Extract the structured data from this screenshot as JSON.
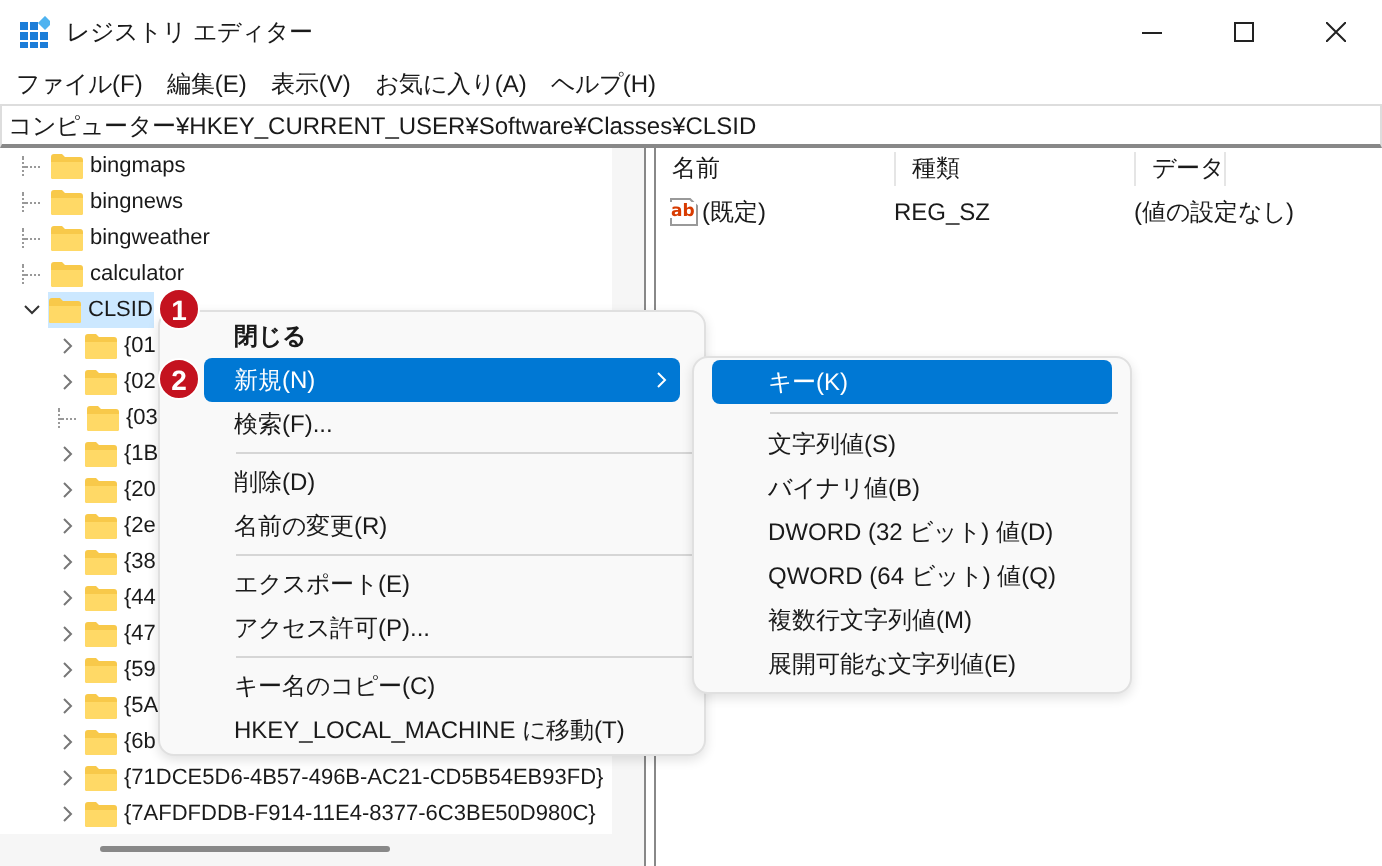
{
  "window": {
    "title": "レジストリ エディター"
  },
  "menu_bar": [
    "ファイル(F)",
    "編集(E)",
    "表示(V)",
    "お気に入り(A)",
    "ヘルプ(H)"
  ],
  "address": "コンピューター¥HKEY_CURRENT_USER¥Software¥Classes¥CLSID",
  "tree": [
    {
      "label": "bingmaps",
      "has_children": false,
      "selected": false
    },
    {
      "label": "bingnews",
      "has_children": false,
      "selected": false
    },
    {
      "label": "bingweather",
      "has_children": false,
      "selected": false
    },
    {
      "label": "calculator",
      "has_children": false,
      "selected": false
    },
    {
      "label": "CLSID",
      "has_children": true,
      "expanded": true,
      "selected": true,
      "children": [
        {
          "label": "{01",
          "has_children": true,
          "expanded": false,
          "selected": false
        },
        {
          "label": "{02",
          "has_children": true,
          "expanded": false,
          "selected": false
        },
        {
          "label": "{03",
          "has_children": false,
          "selected": false
        },
        {
          "label": "{1B",
          "has_children": true,
          "expanded": false,
          "selected": false
        },
        {
          "label": "{20",
          "has_children": true,
          "expanded": false,
          "selected": false
        },
        {
          "label": "{2e",
          "has_children": true,
          "expanded": false,
          "selected": false
        },
        {
          "label": "{38",
          "has_children": true,
          "expanded": false,
          "selected": false
        },
        {
          "label": "{44",
          "has_children": true,
          "expanded": false,
          "selected": false
        },
        {
          "label": "{47",
          "has_children": true,
          "expanded": false,
          "selected": false
        },
        {
          "label": "{59",
          "has_children": true,
          "expanded": false,
          "selected": false
        },
        {
          "label": "{5A",
          "has_children": true,
          "expanded": false,
          "selected": false
        },
        {
          "label": "{6b",
          "has_children": true,
          "expanded": false,
          "selected": false
        },
        {
          "label": "{71DCE5D6-4B57-496B-AC21-CD5B54EB93FD}",
          "has_children": true,
          "expanded": false,
          "selected": false
        },
        {
          "label": "{7AFDFDDB-F914-11E4-8377-6C3BE50D980C}",
          "has_children": true,
          "expanded": false,
          "selected": false
        }
      ]
    }
  ],
  "list": {
    "columns": [
      "名前",
      "種類",
      "データ"
    ],
    "rows": [
      {
        "icon": "ab",
        "name": "(既定)",
        "type": "REG_SZ",
        "data": "(値の設定なし)"
      }
    ]
  },
  "context_menu": [
    {
      "kind": "item",
      "label": "閉じる",
      "default": true,
      "selected": false,
      "has_submenu": false
    },
    {
      "kind": "item",
      "label": "新規(N)",
      "default": false,
      "selected": true,
      "has_submenu": true
    },
    {
      "kind": "item",
      "label": "検索(F)...",
      "default": false,
      "selected": false,
      "has_submenu": false
    },
    {
      "kind": "separator"
    },
    {
      "kind": "item",
      "label": "削除(D)",
      "default": false,
      "selected": false,
      "has_submenu": false
    },
    {
      "kind": "item",
      "label": "名前の変更(R)",
      "default": false,
      "selected": false,
      "has_submenu": false
    },
    {
      "kind": "separator"
    },
    {
      "kind": "item",
      "label": "エクスポート(E)",
      "default": false,
      "selected": false,
      "has_submenu": false
    },
    {
      "kind": "item",
      "label": "アクセス許可(P)...",
      "default": false,
      "selected": false,
      "has_submenu": false
    },
    {
      "kind": "separator"
    },
    {
      "kind": "item",
      "label": "キー名のコピー(C)",
      "default": false,
      "selected": false,
      "has_submenu": false
    },
    {
      "kind": "item",
      "label": "HKEY_LOCAL_MACHINE に移動(T)",
      "default": false,
      "selected": false,
      "has_submenu": false
    }
  ],
  "submenu": [
    {
      "kind": "item",
      "label": "キー(K)",
      "selected": true
    },
    {
      "kind": "separator"
    },
    {
      "kind": "item",
      "label": "文字列値(S)",
      "selected": false
    },
    {
      "kind": "item",
      "label": "バイナリ値(B)",
      "selected": false
    },
    {
      "kind": "item",
      "label": "DWORD (32 ビット) 値(D)",
      "selected": false
    },
    {
      "kind": "item",
      "label": "QWORD (64 ビット) 値(Q)",
      "selected": false
    },
    {
      "kind": "item",
      "label": "複数行文字列値(M)",
      "selected": false
    },
    {
      "kind": "item",
      "label": "展開可能な文字列値(E)",
      "selected": false
    }
  ],
  "callouts": [
    "1",
    "2"
  ]
}
